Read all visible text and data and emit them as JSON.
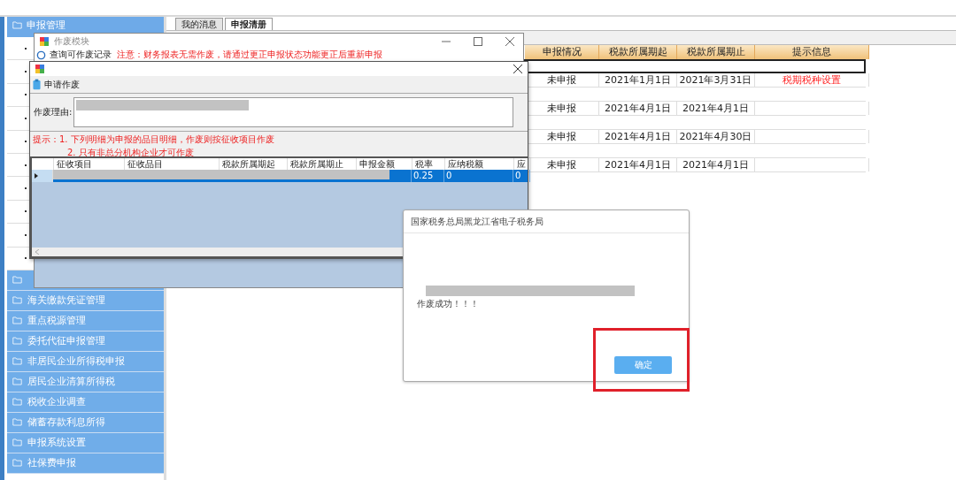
{
  "sidebar": {
    "header": "申报管理",
    "items": [
      {
        "label": "海关缴款凭证管理"
      },
      {
        "label": "重点税源管理"
      },
      {
        "label": "委托代征申报管理"
      },
      {
        "label": "非居民企业所得税申报"
      },
      {
        "label": "居民企业清算所得税"
      },
      {
        "label": "税收企业调查"
      },
      {
        "label": "储蓄存款利息所得"
      },
      {
        "label": "申报系统设置"
      },
      {
        "label": "社保费申报"
      }
    ]
  },
  "tabs": [
    {
      "label": "我的消息",
      "selected": false
    },
    {
      "label": "申报清册",
      "selected": true
    }
  ],
  "table": {
    "columns": [
      "申报情况",
      "税款所属期起",
      "税款所属期止",
      "提示信息"
    ],
    "rows": [
      {
        "kind": "blank",
        "selected": true
      },
      {
        "kind": "data",
        "selected": false,
        "status": "未申报",
        "start": "2021年1月1日",
        "end": "2021年3月31日",
        "hint": "税期税种设置"
      },
      {
        "kind": "blank",
        "selected": false
      },
      {
        "kind": "data",
        "selected": false,
        "status": "未申报",
        "start": "2021年4月1日",
        "end": "2021年4月1日"
      },
      {
        "kind": "blank",
        "selected": false
      },
      {
        "kind": "data",
        "selected": false,
        "status": "未申报",
        "start": "2021年4月1日",
        "end": "2021年4月30日"
      },
      {
        "kind": "blank",
        "selected": false
      },
      {
        "kind": "data",
        "selected": false,
        "status": "未申报",
        "start": "2021年4月1日",
        "end": "2021年4月1日"
      }
    ]
  },
  "module_window": {
    "title": "作废模块",
    "query_label": "查询可作废记录",
    "notice": "注意：财务报表无需作废，请通过更正申报状态功能更正后重新申报"
  },
  "apply_window": {
    "toolbar_label": "申请作废",
    "reason_label": "作废理由:",
    "hint_label": "提示：",
    "hints": [
      "1. 下列明细为申报的品目明细，作废则按征收项目作废",
      "2. 只有非总分机构企业才可作废"
    ],
    "grid": {
      "columns": [
        "征收项目",
        "征收品目",
        "税款所属期起",
        "税款所属期止",
        "申报金额",
        "税率",
        "应纳税额",
        "应"
      ],
      "rows": [
        {
          "selected": true,
          "rate": "0.25",
          "tax": "0",
          "extra": "0"
        }
      ]
    }
  },
  "message_box": {
    "title": "国家税务总局黑龙江省电子税务局",
    "message": "作废成功！！！",
    "button": "确定"
  }
}
